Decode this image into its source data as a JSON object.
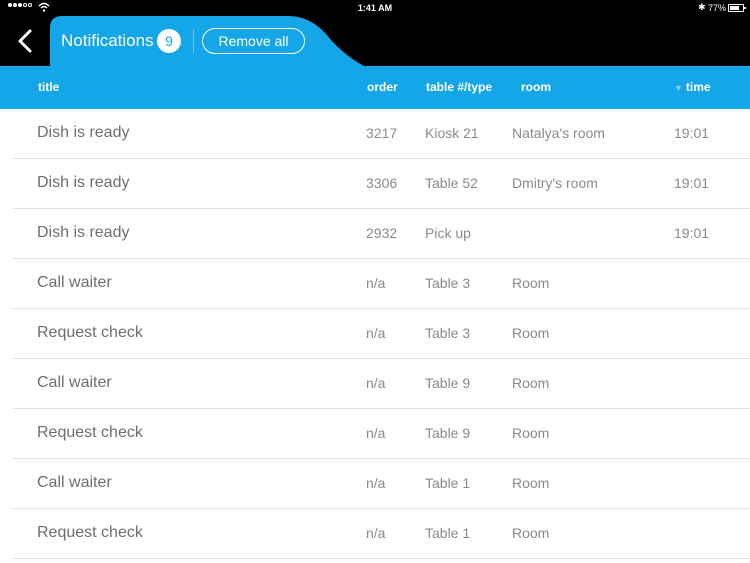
{
  "status_bar": {
    "time": "1:41 AM",
    "battery": "77%",
    "signal_icon": "signal-dots-icon",
    "wifi_icon": "wifi-icon",
    "bluetooth_icon": "bluetooth-icon"
  },
  "nav": {
    "back_icon": "chevron-left-icon",
    "title": "Notifications",
    "count": "9",
    "remove_all": "Remove all"
  },
  "columns": {
    "title": "title",
    "order": "order",
    "table": "table #/type",
    "room": "room",
    "time": "time",
    "sort_icon": "sort-down-triangle-icon"
  },
  "colors": {
    "accent": "#14a6e6",
    "background": "#000000"
  },
  "rows": [
    {
      "title": "Dish is ready",
      "order": "3217",
      "table": "Kiosk 21",
      "room": "Natalya's room",
      "time": "19:01"
    },
    {
      "title": "Dish is ready",
      "order": "3306",
      "table": "Table 52",
      "room": "Dmitry's room",
      "time": "19:01"
    },
    {
      "title": "Dish is ready",
      "order": "2932",
      "table": "Pick up",
      "room": "",
      "time": "19:01"
    },
    {
      "title": "Call waiter",
      "order": "n/a",
      "table": "Table 3",
      "room": "Room",
      "time": ""
    },
    {
      "title": "Request check",
      "order": "n/a",
      "table": "Table 3",
      "room": "Room",
      "time": ""
    },
    {
      "title": "Call waiter",
      "order": "n/a",
      "table": "Table 9",
      "room": "Room",
      "time": ""
    },
    {
      "title": "Request check",
      "order": "n/a",
      "table": "Table 9",
      "room": "Room",
      "time": ""
    },
    {
      "title": "Call waiter",
      "order": "n/a",
      "table": "Table 1",
      "room": "Room",
      "time": ""
    },
    {
      "title": "Request check",
      "order": "n/a",
      "table": "Table 1",
      "room": "Room",
      "time": ""
    }
  ]
}
